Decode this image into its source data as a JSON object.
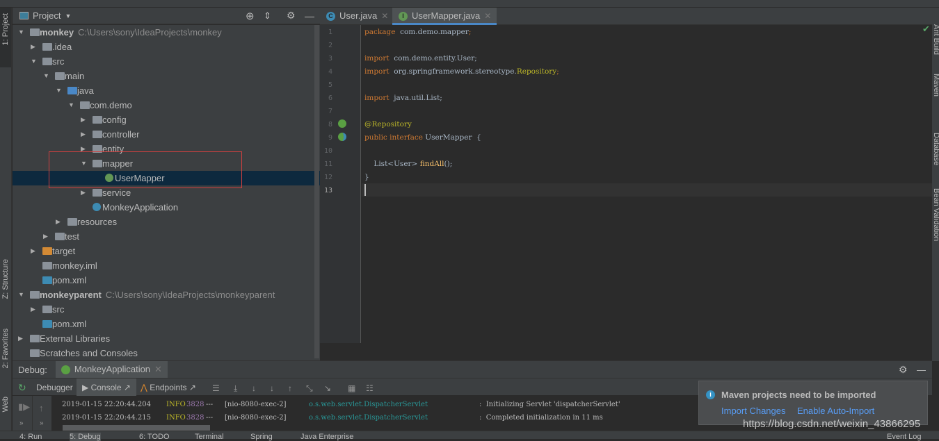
{
  "left_stripe": {
    "project": "1: Project",
    "structure": "Z: Structure",
    "favorites": "2: Favorites",
    "web": "Web"
  },
  "right_stripe": {
    "ant": "Ant Build",
    "maven": "Maven",
    "database": "Database",
    "bean": "Bean Validation"
  },
  "project_panel": {
    "title": "Project"
  },
  "tree": [
    {
      "label": "monkey",
      "hint": "C:\\Users\\sony\\IdeaProjects\\monkey",
      "level": 0,
      "expanded": true,
      "icon": "module-folder",
      "bold": true
    },
    {
      "label": ".idea",
      "level": 1,
      "expanded": false,
      "icon": "folder"
    },
    {
      "label": "src",
      "level": 1,
      "expanded": true,
      "icon": "folder"
    },
    {
      "label": "main",
      "level": 2,
      "expanded": true,
      "icon": "folder"
    },
    {
      "label": "java",
      "level": 3,
      "expanded": true,
      "icon": "source-folder"
    },
    {
      "label": "com.demo",
      "level": 4,
      "expanded": true,
      "icon": "package"
    },
    {
      "label": "config",
      "level": 5,
      "expanded": false,
      "icon": "package"
    },
    {
      "label": "controller",
      "level": 5,
      "expanded": false,
      "icon": "package"
    },
    {
      "label": "entity",
      "level": 5,
      "expanded": false,
      "icon": "package"
    },
    {
      "label": "mapper",
      "level": 5,
      "expanded": true,
      "icon": "package"
    },
    {
      "label": "UserMapper",
      "level": 6,
      "icon": "interface",
      "selected": true
    },
    {
      "label": "service",
      "level": 5,
      "expanded": false,
      "icon": "package"
    },
    {
      "label": "MonkeyApplication",
      "level": 5,
      "icon": "spring-class"
    },
    {
      "label": "resources",
      "level": 3,
      "expanded": false,
      "icon": "resources-folder"
    },
    {
      "label": "test",
      "level": 2,
      "expanded": false,
      "icon": "folder"
    },
    {
      "label": "target",
      "level": 1,
      "expanded": false,
      "icon": "excluded-folder"
    },
    {
      "label": "monkey.iml",
      "level": 1,
      "icon": "iml-file"
    },
    {
      "label": "pom.xml",
      "level": 1,
      "icon": "maven-file"
    },
    {
      "label": "monkeyparent",
      "hint": "C:\\Users\\sony\\IdeaProjects\\monkeyparent",
      "level": 0,
      "expanded": true,
      "icon": "module-folder",
      "bold": true
    },
    {
      "label": "src",
      "level": 1,
      "expanded": false,
      "icon": "folder"
    },
    {
      "label": "pom.xml",
      "level": 1,
      "icon": "maven-file"
    },
    {
      "label": "External Libraries",
      "level": 0,
      "expanded": false,
      "icon": "libraries"
    },
    {
      "label": "Scratches and Consoles",
      "level": 0,
      "icon": "scratches"
    }
  ],
  "editor": {
    "tabs": [
      {
        "label": "User.java",
        "icon": "C",
        "active": false
      },
      {
        "label": "UserMapper.java",
        "icon": "I",
        "active": true
      }
    ],
    "lines": [
      [
        [
          "kw",
          "package"
        ],
        [
          "",
          "  com.demo.mapper"
        ],
        [
          "kw",
          ";"
        ]
      ],
      [],
      [
        [
          "kw",
          "import"
        ],
        [
          "",
          "  com.demo.entity.User;"
        ]
      ],
      [
        [
          "kw",
          "import"
        ],
        [
          "",
          "  org.springframework.stereotype."
        ],
        [
          "an",
          "Repository"
        ],
        [
          "kw",
          ";"
        ]
      ],
      [],
      [
        [
          "kw",
          "import"
        ],
        [
          "",
          "  java.util.List;"
        ]
      ],
      [],
      [
        [
          "an",
          "@Repository"
        ]
      ],
      [
        [
          "kw",
          "public interface"
        ],
        [
          "",
          " UserMapper  {"
        ]
      ],
      [],
      [
        [
          "",
          "    List<User> "
        ],
        [
          "fn",
          "findAll"
        ],
        [
          "",
          "();"
        ]
      ],
      [
        [
          "",
          "}"
        ]
      ],
      []
    ]
  },
  "debug": {
    "label": "Debug:",
    "session": "MonkeyApplication",
    "tabs": {
      "debugger": "Debugger",
      "console": "Console",
      "endpoints": "Endpoints"
    },
    "log": [
      {
        "time": "2019-01-15 22:20:44.204",
        "level": "INFO",
        "pid": "3828",
        "sep": "---",
        "thread": "[nio-8080-exec-2]",
        "logger": "o.s.web.servlet.DispatcherServlet",
        "msg": ":  Initializing Servlet 'dispatcherServlet'"
      },
      {
        "time": "2019-01-15 22:20:44.215",
        "level": "INFO",
        "pid": "3828",
        "sep": "---",
        "thread": "[nio-8080-exec-2]",
        "logger": "o.s.web.servlet.DispatcherServlet",
        "msg": ":  Completed initialization in 11 ms"
      }
    ]
  },
  "notification": {
    "title": "Maven projects need to be imported",
    "import": "Import Changes",
    "auto": "Enable Auto-Import"
  },
  "bottom_tabs": [
    "4: Run",
    "5: Debug",
    "6: TODO",
    "Terminal",
    "Spring",
    "Java Enterprise",
    "Event Log"
  ],
  "watermark": "https://blog.csdn.net/weixin_43866295",
  "colors": {
    "keyword": "#cc7832",
    "annotation": "#bbb529",
    "method": "#ffc66d",
    "link": "#589df6",
    "selection": "#0d293e"
  }
}
